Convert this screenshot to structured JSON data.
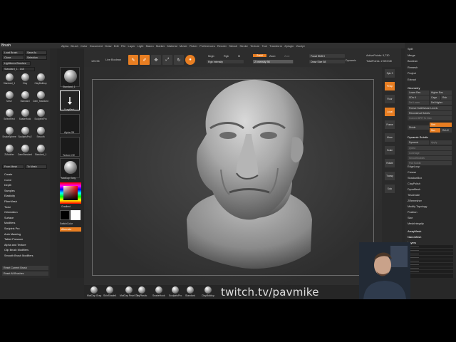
{
  "menu": {
    "left_items": [
      "Alpha",
      "Brush"
    ],
    "items": [
      "Alpha",
      "Brush",
      "Color",
      "Document",
      "Draw",
      "Edit",
      "File",
      "Layer",
      "Light",
      "Macro",
      "Marker",
      "Material",
      "Movie",
      "Picker",
      "Preferences",
      "Render",
      "Stencil",
      "Stroke",
      "Texture",
      "Tool",
      "Transform",
      "Zplugin",
      "Zscript"
    ]
  },
  "left_palette": {
    "title": "Brush",
    "buttons": [
      {
        "label": "Load Brush"
      },
      {
        "label": "Save As"
      },
      {
        "label": "Clone"
      },
      {
        "label": "Selection"
      },
      {
        "label": "Lightbox ▸ Brushes"
      },
      {
        "label": "Standard_1 . 148"
      }
    ],
    "brushes": [
      "Standard_1",
      "Clay",
      "ClayBuildup",
      "Move",
      "Standard",
      "Dam_Standard",
      "SelectRect",
      "SnakeHook",
      "SculptrisPro",
      "SnakeSphere",
      "SculptrisPro2",
      "Smooth",
      "ZModeler",
      "DamStandard",
      "Standard_1"
    ],
    "from_mesh": "From Mesh",
    "to_mesh": "To Mesh",
    "menu_items": [
      "Create",
      "Curve",
      "Depth",
      "Samples",
      "Elasticity",
      "FiberMesh",
      "Twist",
      "Orientation",
      "Surface",
      "Modifiers",
      "Sculptris Pro",
      "Auto Masking",
      "Tablet Pressure",
      "Alpha and Texture",
      "Clip Brush Modifiers",
      "Smooth Brush Modifiers"
    ],
    "reset_current": "Reset Current Brush",
    "reset_all": "Reset All Brushes"
  },
  "shelf": {
    "brush_label": "Standard_1",
    "stroke_label": "DragRect",
    "alpha_label": "Alpha Off",
    "texture_label": "Texture Off",
    "material_label": "MatCap Gray",
    "gradient_label": "Gradient",
    "switch_label": "SwitchColor",
    "alternate_label": "Alternate",
    "colors": {
      "main": "#000000",
      "secondary": "#ffffff",
      "accent": "#e87e22"
    }
  },
  "toolbar": {
    "tool_buttons": [
      "Edit",
      "Draw",
      "Move",
      "Scale",
      "Rotate"
    ],
    "live_boolean": "Live Boolean",
    "resolution": "125.96",
    "mrgb": "Mrgb",
    "rgb": "Rgb",
    "m": "M",
    "rgb_intensity": "Rgb Intensity",
    "zadd": "Zadd",
    "zsub": "Zsub",
    "zcut": "Zcut",
    "z_intensity": "Z Intensity 98",
    "z_intensity_value": 0.98,
    "focal_shift": "Focal Shift 0",
    "draw_size": "Draw Size 58",
    "dynamic": "Dynamic",
    "active_points": "ActivePoints: 9,730",
    "total_points": "TotalPoints: 2.593 Mil"
  },
  "right_shelf": [
    "Spix 3",
    "Persp",
    "Floor",
    "Local",
    "Frame",
    "Move",
    "Scale",
    "Rotate",
    "Transp",
    "Solo"
  ],
  "right_palette": {
    "top_items": [
      "Split",
      "Merge",
      "Boolean",
      "Remesh",
      "Project",
      "Extract"
    ],
    "geometry_title": "Geometry",
    "lower_res": "Lower Res",
    "higher_res": "Higher Res",
    "sdiv": "SDiv 6",
    "cage": "Cage",
    "rstr": "Rstr",
    "del_lower": "Del Lower",
    "del_higher": "Del Higher",
    "freeze": "Freeze SubDivision Levels",
    "reconstruct": "Reconstruct Subdiv",
    "convert": "Convert BPR To Geo",
    "divide": "Divide",
    "smt": "Smt",
    "suv": "Suv",
    "rsuv": "ReUV",
    "dynamic_subdiv": "Dynamic Subdiv",
    "dynamic": "Dynamic",
    "apply": "Apply",
    "qgrid": "QGrid",
    "coverage": "Coverage",
    "smoothsubdiv": "SmoothSubdiv",
    "flat": "Flat Subdiv",
    "items": [
      "EdgeLoop",
      "Crease",
      "ShadowBox",
      "ClayPolish",
      "DynaMesh",
      "Tessimate",
      "ZRemesher",
      "Modify Topology",
      "Position",
      "Size",
      "MeshIntegrity"
    ],
    "arraymesh": "ArrayMesh",
    "nanomesh": "NanoMesh",
    "layers_title": "Layers",
    "layer_rows": 8
  },
  "bottom_shelf": [
    "MatCap Gray",
    "SkinShade4",
    "MatCap Pearl Ca",
    "ToyPlastic",
    "SnakeHook",
    "SculptrisPro",
    "Standard",
    "ClayBuildup"
  ],
  "watermark": "twitch.tv/pavmike"
}
